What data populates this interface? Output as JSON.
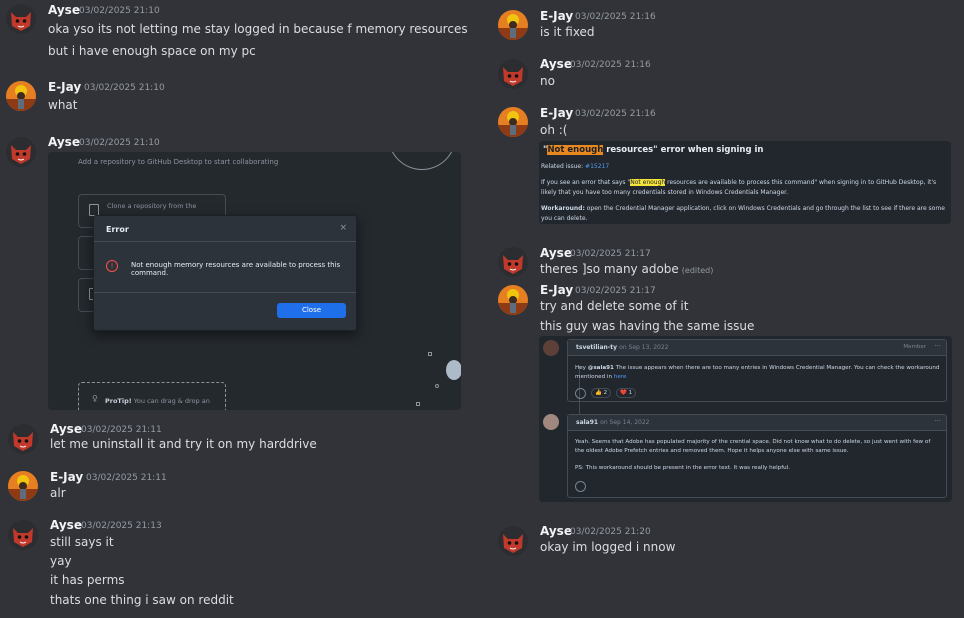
{
  "left_messages": [
    {
      "user": "Ayse",
      "time": "03/02/2025 21:10",
      "lines": [
        "oka yso its not letting me stay logged in because f memory resources",
        "but i have enough space on my pc"
      ]
    },
    {
      "user": "E-Jay",
      "time": "03/02/2025 21:10",
      "lines": [
        "what"
      ]
    },
    {
      "user": "Ayse",
      "time": "03/02/2025 21:10",
      "lines": []
    },
    {
      "user": "Ayse",
      "time": "03/02/2025 21:11",
      "lines": [
        "let me uninstall it and try it on my harddrive"
      ]
    },
    {
      "user": "E-Jay",
      "time": "03/02/2025 21:11",
      "lines": [
        "alr"
      ]
    },
    {
      "user": "Ayse",
      "time": "03/02/2025 21:13",
      "lines": [
        "still says it",
        "yay",
        "it has perms",
        "thats one thing i saw on reddit"
      ]
    }
  ],
  "right_messages": [
    {
      "user": "E-Jay",
      "time": "03/02/2025 21:16",
      "lines": [
        "is it fixed"
      ]
    },
    {
      "user": "Ayse",
      "time": "03/02/2025 21:16",
      "lines": [
        "no"
      ]
    },
    {
      "user": "E-Jay",
      "time": "03/02/2025 21:16",
      "lines": [
        "oh :("
      ]
    },
    {
      "user": "Ayse",
      "time": "03/02/2025 21:17",
      "lines": [
        "theres ]so many adobe"
      ],
      "edited": "(edited)"
    },
    {
      "user": "E-Jay",
      "time": "03/02/2025 21:17",
      "lines": [
        "try and delete some of it",
        "this guy was having the same issue"
      ]
    },
    {
      "user": "Ayse",
      "time": "03/02/2025 21:20",
      "lines": [
        "okay im logged i nnow"
      ]
    }
  ],
  "github_desktop": {
    "hint": "Add a repository to GitHub Desktop to start collaborating",
    "clone_option": "Clone a repository from the",
    "dialog_title": "Error",
    "dialog_close_x": "×",
    "dialog_message": "Not enough memory resources are available to process this command.",
    "dialog_button": "Close",
    "protip_bold": "ProTip!",
    "protip_text": " You can drag & drop an"
  },
  "error_doc": {
    "title_q1": "\"",
    "title_hl": "Not enough",
    "title_rest": " resources\" error when signing in",
    "related_label": "Related issue: ",
    "related_link": "#15217",
    "p1_a": "If you see an error that says \"",
    "p1_hl": "Not enough",
    "p1_b": " resources are available to process this command\" when signing in to GitHub Desktop, it's likely that you have too many credentials stored in Windows Credentials Manager.",
    "workaround_label": "Workaround:",
    "workaround_text": " open the Credential Manager application, click on Windows Credentials and go through the list to see if there are some you can delete."
  },
  "issue_comments": [
    {
      "author": "tsvetilian-ty",
      "date": "on Sep 13, 2022",
      "role": "Member",
      "more": "···",
      "text_a": "Hey ",
      "mention": "@sala91",
      "text_b": " The issue appears when there are too many entries in Windows Credential Manager. You can check the workaround mentioned in ",
      "link": "here",
      "reactions": [
        "👍 2",
        "❤️ 1"
      ]
    },
    {
      "author": "sala91",
      "date": "on Sep 14, 2022",
      "more": "···",
      "text_1": "Yeah. Seems that Adobe has populated majority of the crential space. Did not know what to do delete, so just went with few of the oldest Adobe Prefetch entries and removed them. Hope it helps anyone else with same issue.",
      "text_2": "PS: This workaround should be present in the error text. It was really helpful."
    }
  ],
  "colors": {
    "background": "#313338",
    "ayse_avatar": "#c0392b",
    "ejay_avatar": "#e67e22",
    "hl_orange": "#e8881f",
    "hl_yellow": "#f5e43b",
    "dialog_button": "#1f6feb"
  }
}
